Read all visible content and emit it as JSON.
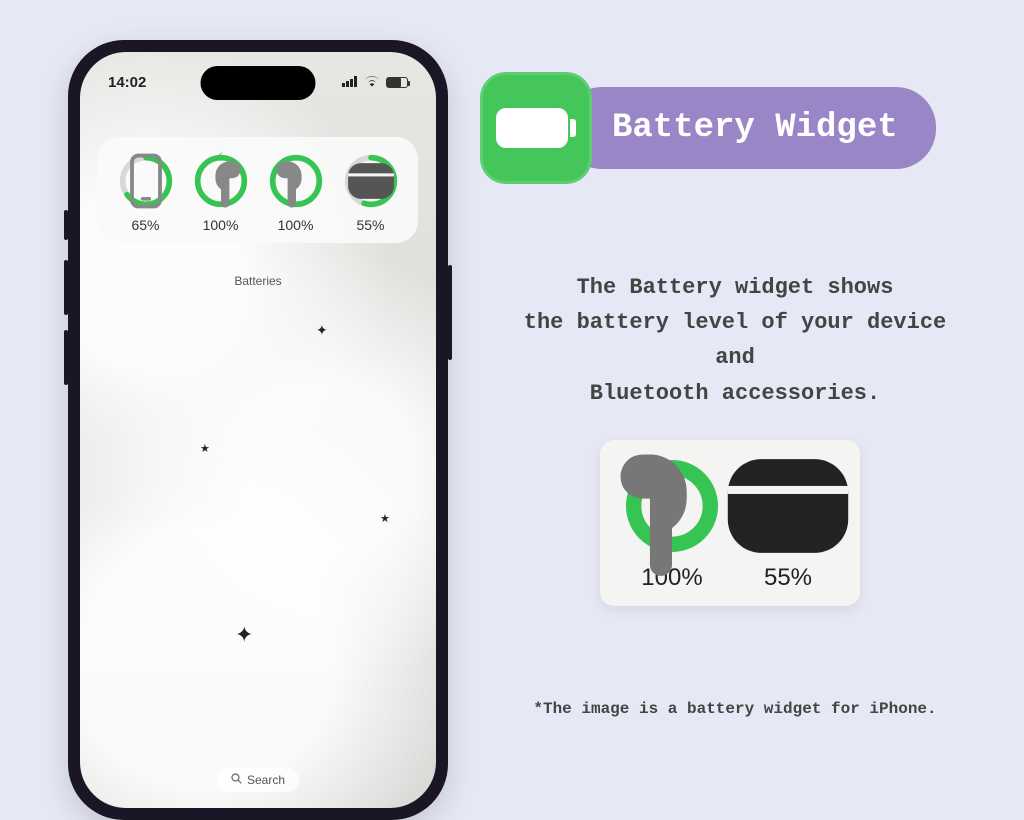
{
  "title": "Battery Widget",
  "description_l1": "The Battery widget shows",
  "description_l2": "the battery level of your device and",
  "description_l3": "Bluetooth accessories.",
  "footnote": "*The image is a battery widget for iPhone.",
  "colors": {
    "accent": "#36c552",
    "pill": "#9a86c7"
  },
  "phone": {
    "time": "14:02",
    "widget_label": "Batteries",
    "search_label": "Search",
    "items": [
      {
        "device": "phone",
        "percent": 65,
        "label": "65%",
        "charging": false
      },
      {
        "device": "airpod-left",
        "percent": 100,
        "label": "100%",
        "charging": true
      },
      {
        "device": "airpod-right",
        "percent": 100,
        "label": "100%",
        "charging": false
      },
      {
        "device": "case",
        "percent": 55,
        "label": "55%",
        "charging": false
      }
    ]
  },
  "zoom": {
    "items": [
      {
        "device": "airpod-right",
        "percent": 100,
        "label": "100%"
      },
      {
        "device": "case",
        "percent": 55,
        "label": "55%"
      }
    ]
  }
}
